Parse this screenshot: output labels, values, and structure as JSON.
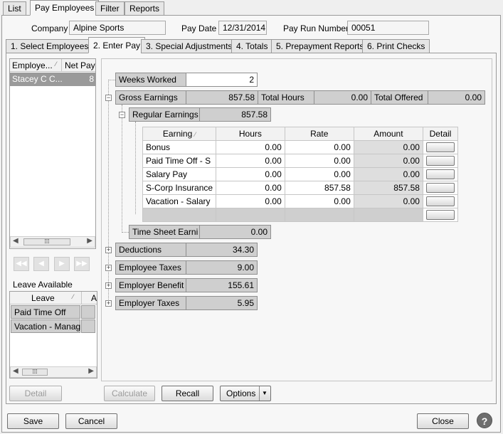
{
  "top_tabs": [
    "List",
    "Pay Employees",
    "Filter",
    "Reports"
  ],
  "header": {
    "company_label": "Company",
    "company": "Alpine Sports",
    "paydate_label": "Pay Date",
    "paydate": "12/31/2014",
    "payrun_label": "Pay Run Number",
    "payrun": "00051"
  },
  "step_tabs": [
    "1. Select Employees",
    "2. Enter Pay",
    "3. Special Adjustments",
    "4. Totals",
    "5. Prepayment Reports",
    "6. Print Checks"
  ],
  "emp_list": {
    "col1": "Employe...",
    "col2": "Net Pay",
    "rows": [
      {
        "name": "Stacey C C...",
        "net": "8"
      }
    ]
  },
  "leave": {
    "title": "Leave Available",
    "col": "Leave",
    "col2": "A",
    "rows": [
      "Paid Time Off",
      "Vacation - Manag"
    ]
  },
  "left_detail_button": "Detail",
  "weeks_worked_label": "Weeks Worked",
  "weeks_worked": "2",
  "gross": {
    "label": "Gross Earnings",
    "value": "857.58",
    "hours_label": "Total Hours",
    "hours": "0.00",
    "offered_label": "Total Offered",
    "offered": "0.00"
  },
  "regular": {
    "label": "Regular Earnings",
    "value": "857.58"
  },
  "earn_table": {
    "headers": [
      "Earning",
      "Hours",
      "Rate",
      "Amount",
      "Detail"
    ],
    "rows": [
      {
        "earning": "Bonus",
        "hours": "0.00",
        "rate": "0.00",
        "amount": "0.00"
      },
      {
        "earning": "Paid Time Off - S",
        "hours": "0.00",
        "rate": "0.00",
        "amount": "0.00"
      },
      {
        "earning": "Salary Pay",
        "hours": "0.00",
        "rate": "0.00",
        "amount": "0.00"
      },
      {
        "earning": "S-Corp Insurance",
        "hours": "0.00",
        "rate": "857.58",
        "amount": "857.58"
      },
      {
        "earning": "Vacation - Salary",
        "hours": "0.00",
        "rate": "0.00",
        "amount": "0.00"
      }
    ]
  },
  "timesheet": {
    "label": "Time Sheet Earni",
    "value": "0.00"
  },
  "summary": [
    {
      "label": "Deductions",
      "value": "34.30"
    },
    {
      "label": "Employee Taxes",
      "value": "9.00"
    },
    {
      "label": "Employer Benefit",
      "value": "155.61"
    },
    {
      "label": "Employer Taxes",
      "value": "5.95"
    }
  ],
  "buttons": {
    "calculate": "Calculate",
    "recall": "Recall",
    "options": "Options",
    "save": "Save",
    "cancel": "Cancel",
    "close": "Close"
  }
}
